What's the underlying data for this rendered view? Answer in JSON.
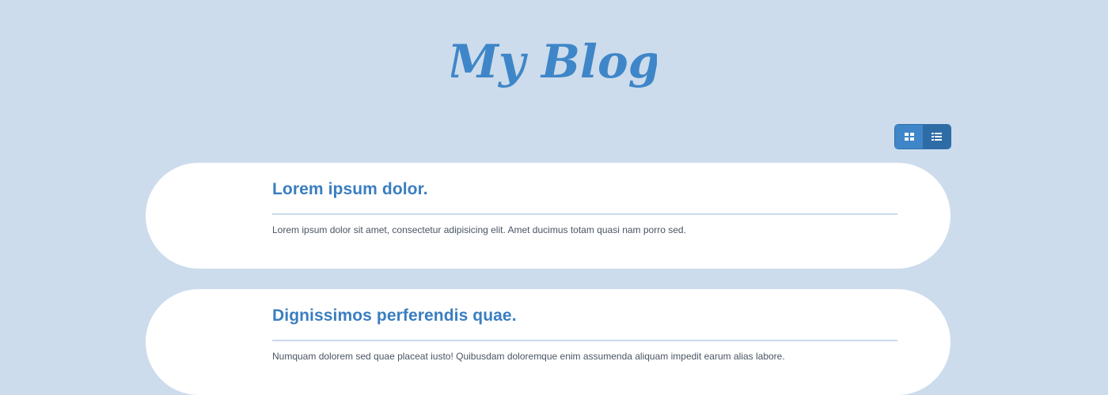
{
  "header": {
    "logo_text": "My Blog",
    "logo_color": "#3f86c8"
  },
  "view_toggle": {
    "options": [
      {
        "icon": "grid-icon",
        "active": true
      },
      {
        "icon": "list-icon",
        "active": false
      }
    ]
  },
  "posts": [
    {
      "title": "Lorem ipsum dolor.",
      "excerpt": "Lorem ipsum dolor sit amet, consectetur adipisicing elit. Amet ducimus totam quasi nam porro sed."
    },
    {
      "title": "Dignissimos perferendis quae.",
      "excerpt": "Numquam dolorem sed quae placeat iusto! Quibusdam doloremque enim assumenda aliquam impedit earum alias labore."
    }
  ],
  "colors": {
    "background": "#ccdcec",
    "accent": "#3a7ec0",
    "card": "#ffffff"
  }
}
